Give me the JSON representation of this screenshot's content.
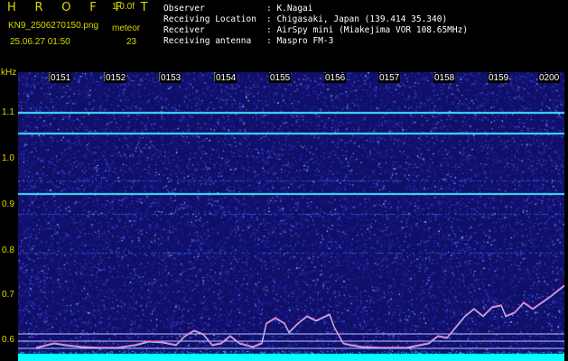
{
  "header": {
    "logo": "H R O F F T",
    "version": "1.0.0f",
    "filename": "KN9_2506270150.png",
    "meteor_label": "meteor",
    "datetime": "25.06.27 01:50",
    "count": "23"
  },
  "info": {
    "observer_label": "Observer",
    "observer_value": ": K.Nagai",
    "location_label": "Receiving Location",
    "location_value": ": Chigasaki, Japan (139.414 35.340)",
    "receiver_label": "Receiver",
    "receiver_value": ": AirSpy mini (Miakejima VOR 108.65MHz)",
    "antenna_label": "Receiving antenna",
    "antenna_value": ": Maspro FM-3"
  },
  "axis": {
    "unit": "kHz",
    "freq_labels": [
      "1.1",
      "1.0",
      "0.9",
      "0.8",
      "0.7",
      "0.6"
    ],
    "time_labels": [
      "0151",
      "0152",
      "0153",
      "0154",
      "0155",
      "0156",
      "0157",
      "0158",
      "0159",
      "0200"
    ]
  },
  "colors": {
    "background": "#000000",
    "spectrogram_base": "#10106a",
    "carrier": "#40e8ff",
    "meteor_trace": "#ff60c0",
    "label_yellow": "#d8d800",
    "baseline_cyan": "#00ffff"
  }
}
